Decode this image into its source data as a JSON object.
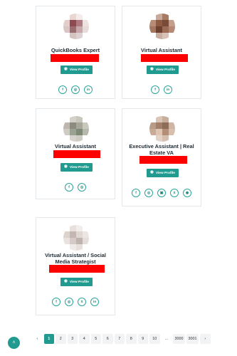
{
  "cards": [
    {
      "title": "QuickBooks Expert",
      "button_label": "View Profile",
      "social_icons": [
        "facebook-icon",
        "instagram-icon",
        "linkedin-icon"
      ],
      "social_glyphs": [
        "f",
        "◎",
        "in"
      ]
    },
    {
      "title": "Virtual Assistant",
      "button_label": "View Profile",
      "social_icons": [
        "facebook-icon",
        "linkedin-icon"
      ],
      "social_glyphs": [
        "f",
        "in"
      ]
    },
    {
      "title": "Virtual Assistant",
      "button_label": "View Profile",
      "social_icons": [
        "facebook-icon",
        "instagram-icon"
      ],
      "social_glyphs": [
        "f",
        "◎"
      ]
    },
    {
      "title": "Executive Assistant | Real Estate VA",
      "button_label": "View Profile",
      "social_icons": [
        "facebook-icon",
        "instagram-icon",
        "linkedin-square-icon",
        "skype-icon",
        "website-icon"
      ],
      "social_glyphs": [
        "f",
        "◎",
        "▣",
        "S",
        "◉"
      ]
    },
    {
      "title": "Virtual Assistant / Social Media Strategist",
      "button_label": "View Profile",
      "social_icons": [
        "facebook-icon",
        "instagram-icon",
        "skype-icon",
        "linkedin-icon"
      ],
      "social_glyphs": [
        "f",
        "◎",
        "S",
        "in"
      ]
    }
  ],
  "pagination": {
    "prev": "‹",
    "pages": [
      "1",
      "2",
      "3",
      "4",
      "5",
      "6",
      "7",
      "8",
      "9",
      "10"
    ],
    "current": "1",
    "ellipsis": "...",
    "last_pages": [
      "3000",
      "3001"
    ],
    "next": "›"
  },
  "scroll_top": {
    "icon": "chevron-up-icon",
    "glyph": "˄"
  },
  "colors": {
    "accent": "#219b8f",
    "redaction": "#ff0000",
    "card_border": "#e4e7ea",
    "title_text": "#1e2a33"
  }
}
